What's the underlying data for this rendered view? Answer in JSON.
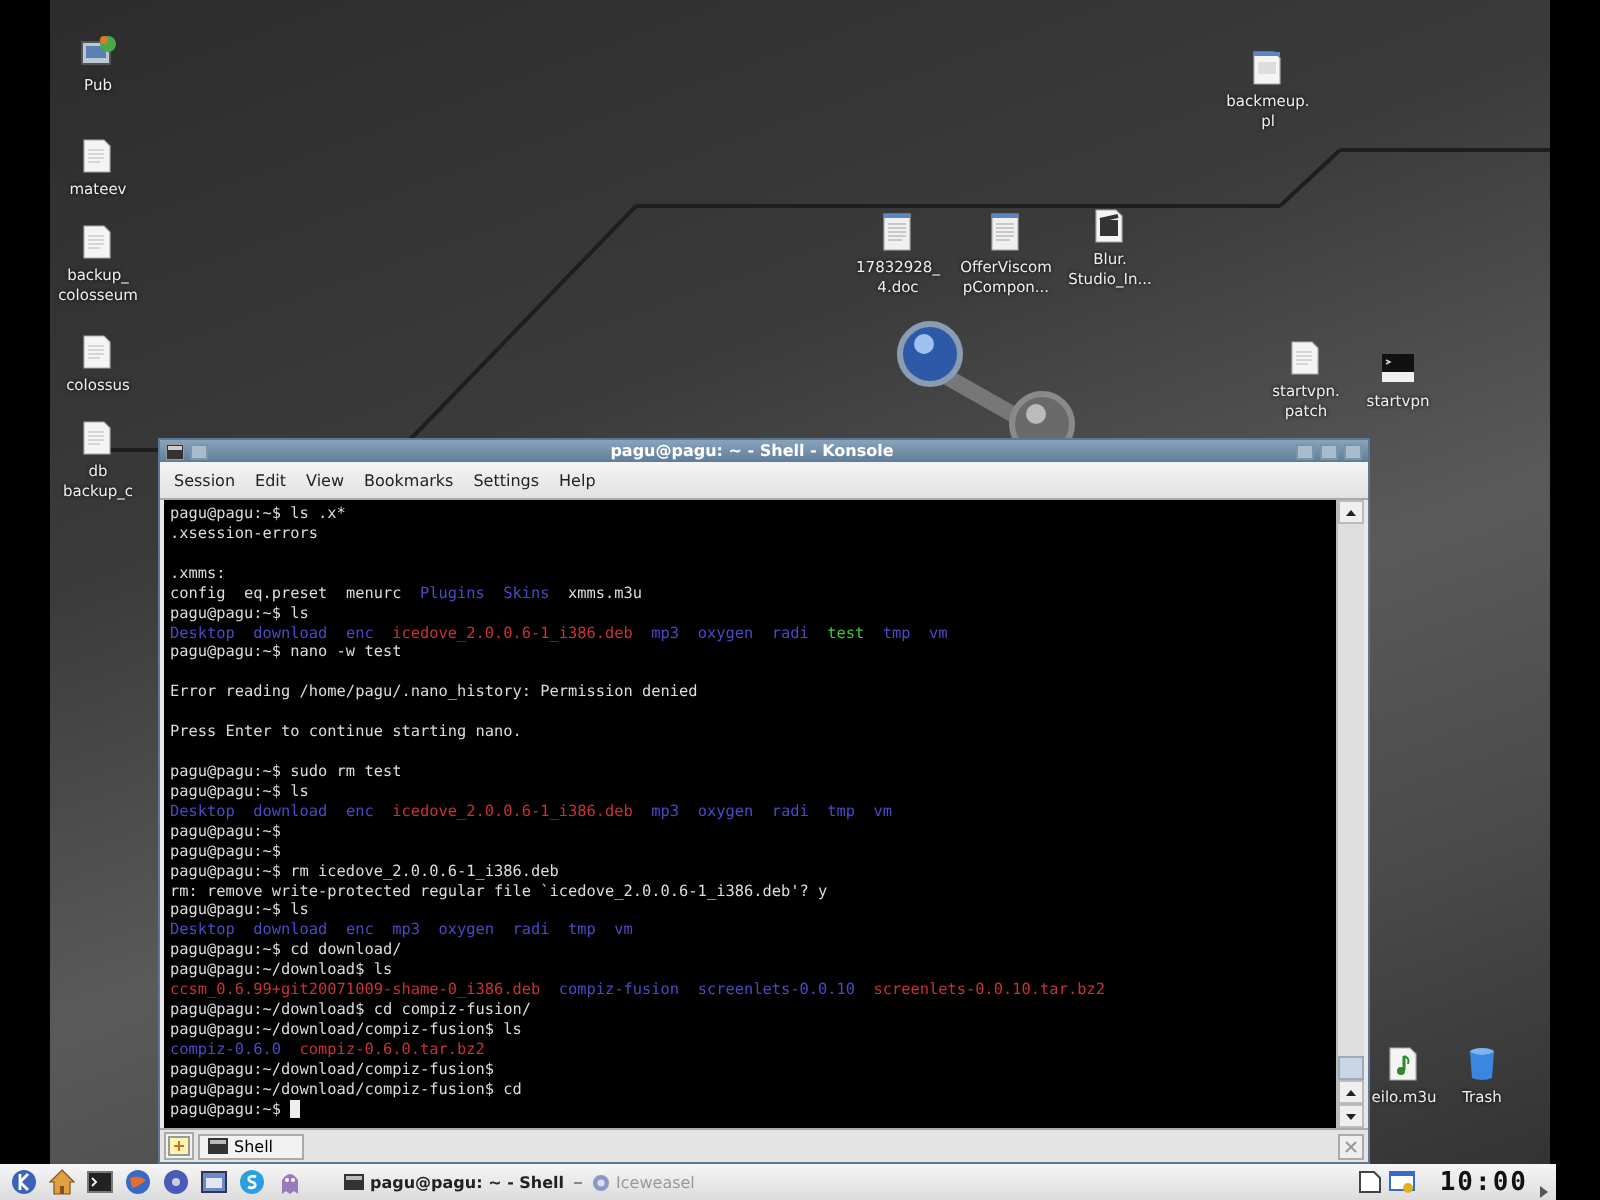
{
  "desktop_icons": [
    {
      "kind": "app",
      "label": [
        "Pub"
      ]
    },
    {
      "kind": "document",
      "label": [
        "mateev"
      ]
    },
    {
      "kind": "document",
      "label": [
        "backup_",
        "colosseum"
      ]
    },
    {
      "kind": "document",
      "label": [
        "colossus"
      ]
    },
    {
      "kind": "document",
      "label": [
        "db",
        "backup_c"
      ]
    },
    {
      "kind": "script",
      "label": [
        "backmeup.",
        "pl"
      ]
    },
    {
      "kind": "office",
      "label": [
        "17832928_",
        "4.doc"
      ]
    },
    {
      "kind": "office",
      "label": [
        "OfferViscom",
        "pCompon..."
      ]
    },
    {
      "kind": "video",
      "label": [
        "Blur.",
        "Studio_In..."
      ]
    },
    {
      "kind": "document",
      "label": [
        "startvpn.",
        "patch"
      ]
    },
    {
      "kind": "terminal",
      "label": [
        "startvpn"
      ]
    },
    {
      "kind": "audio",
      "label": [
        "eilo.m3u"
      ]
    },
    {
      "kind": "trash",
      "label": [
        "Trash"
      ]
    }
  ],
  "window": {
    "title": "pagu@pagu: ~ - Shell - Konsole",
    "active": true,
    "menu": [
      "Session",
      "Edit",
      "View",
      "Bookmarks",
      "Settings",
      "Help"
    ],
    "terminal": {
      "cursor": true,
      "lines": [
        {
          "kind": "text",
          "text": "pagu@pagu:~$ ls .x*"
        },
        {
          "kind": "text",
          "text": ".xsession-errors"
        },
        {
          "kind": "blank"
        },
        {
          "kind": "text",
          "text": ".xmms:"
        },
        {
          "kind": "listing",
          "entries": [
            {
              "text": "config",
              "color": "#dcdcdc"
            },
            {
              "text": "eq.preset",
              "color": "#dcdcdc"
            },
            {
              "text": "menurc",
              "color": "#dcdcdc"
            },
            {
              "text": "Plugins",
              "color": "#4a4ac8"
            },
            {
              "text": "Skins",
              "color": "#4a4ac8"
            },
            {
              "text": "xmms.m3u",
              "color": "#dcdcdc"
            }
          ]
        },
        {
          "kind": "text",
          "text": "pagu@pagu:~$ ls"
        },
        {
          "kind": "listing",
          "entries": [
            {
              "text": "Desktop",
              "color": "#4a4ac8"
            },
            {
              "text": "download",
              "color": "#4a4ac8"
            },
            {
              "text": "enc",
              "color": "#4a4ac8"
            },
            {
              "text": "icedove_2.0.0.6-1_i386.deb",
              "color": "#c83232"
            },
            {
              "text": "mp3",
              "color": "#4a4ac8"
            },
            {
              "text": "oxygen",
              "color": "#4a4ac8"
            },
            {
              "text": "radi",
              "color": "#4a4ac8"
            },
            {
              "text": "test",
              "color": "#3cc83c"
            },
            {
              "text": "tmp",
              "color": "#4a4ac8"
            },
            {
              "text": "vm",
              "color": "#4a4ac8"
            }
          ]
        },
        {
          "kind": "text",
          "text": "pagu@pagu:~$ nano -w test"
        },
        {
          "kind": "blank"
        },
        {
          "kind": "text",
          "text": "Error reading /home/pagu/.nano_history: Permission denied"
        },
        {
          "kind": "blank"
        },
        {
          "kind": "text",
          "text": "Press Enter to continue starting nano."
        },
        {
          "kind": "blank"
        },
        {
          "kind": "text",
          "text": "pagu@pagu:~$ sudo rm test"
        },
        {
          "kind": "text",
          "text": "pagu@pagu:~$ ls"
        },
        {
          "kind": "listing",
          "entries": [
            {
              "text": "Desktop",
              "color": "#4a4ac8"
            },
            {
              "text": "download",
              "color": "#4a4ac8"
            },
            {
              "text": "enc",
              "color": "#4a4ac8"
            },
            {
              "text": "icedove_2.0.0.6-1_i386.deb",
              "color": "#c83232"
            },
            {
              "text": "mp3",
              "color": "#4a4ac8"
            },
            {
              "text": "oxygen",
              "color": "#4a4ac8"
            },
            {
              "text": "radi",
              "color": "#4a4ac8"
            },
            {
              "text": "tmp",
              "color": "#4a4ac8"
            },
            {
              "text": "vm",
              "color": "#4a4ac8"
            }
          ]
        },
        {
          "kind": "text",
          "text": "pagu@pagu:~$"
        },
        {
          "kind": "text",
          "text": "pagu@pagu:~$"
        },
        {
          "kind": "text",
          "text": "pagu@pagu:~$ rm icedove_2.0.0.6-1_i386.deb"
        },
        {
          "kind": "text",
          "text": "rm: remove write-protected regular file `icedove_2.0.0.6-1_i386.deb'? y"
        },
        {
          "kind": "text",
          "text": "pagu@pagu:~$ ls"
        },
        {
          "kind": "listing",
          "entries": [
            {
              "text": "Desktop",
              "color": "#4a4ac8"
            },
            {
              "text": "download",
              "color": "#4a4ac8"
            },
            {
              "text": "enc",
              "color": "#4a4ac8"
            },
            {
              "text": "mp3",
              "color": "#4a4ac8"
            },
            {
              "text": "oxygen",
              "color": "#4a4ac8"
            },
            {
              "text": "radi",
              "color": "#4a4ac8"
            },
            {
              "text": "tmp",
              "color": "#4a4ac8"
            },
            {
              "text": "vm",
              "color": "#4a4ac8"
            }
          ]
        },
        {
          "kind": "text",
          "text": "pagu@pagu:~$ cd download/"
        },
        {
          "kind": "text",
          "text": "pagu@pagu:~/download$ ls"
        },
        {
          "kind": "listing",
          "entries": [
            {
              "text": "ccsm_0.6.99+git20071009-shame-0_i386.deb",
              "color": "#c83232"
            },
            {
              "text": "compiz-fusion",
              "color": "#4a4ac8"
            },
            {
              "text": "screenlets-0.0.10",
              "color": "#4a4ac8"
            },
            {
              "text": "screenlets-0.0.10.tar.bz2",
              "color": "#c83232"
            }
          ]
        },
        {
          "kind": "text",
          "text": "pagu@pagu:~/download$ cd compiz-fusion/"
        },
        {
          "kind": "text",
          "text": "pagu@pagu:~/download/compiz-fusion$ ls"
        },
        {
          "kind": "listing",
          "entries": [
            {
              "text": "compiz-0.6.0",
              "color": "#4a4ac8"
            },
            {
              "text": "compiz-0.6.0.tar.bz2",
              "color": "#c83232"
            }
          ]
        },
        {
          "kind": "text",
          "text": "pagu@pagu:~/download/compiz-fusion$"
        },
        {
          "kind": "text",
          "text": "pagu@pagu:~/download/compiz-fusion$ cd"
        },
        {
          "kind": "text",
          "text": "pagu@pagu:~$"
        }
      ]
    },
    "tabs": [
      {
        "label": "Shell",
        "selected": true
      }
    ]
  },
  "taskbar": {
    "tasks": [
      {
        "label": "pagu@pagu: ~ - Shell",
        "kind": "terminal",
        "minimized": false
      },
      {
        "label": "Iceweasel",
        "kind": "browser",
        "minimized": true
      }
    ],
    "clock": "10:00"
  }
}
